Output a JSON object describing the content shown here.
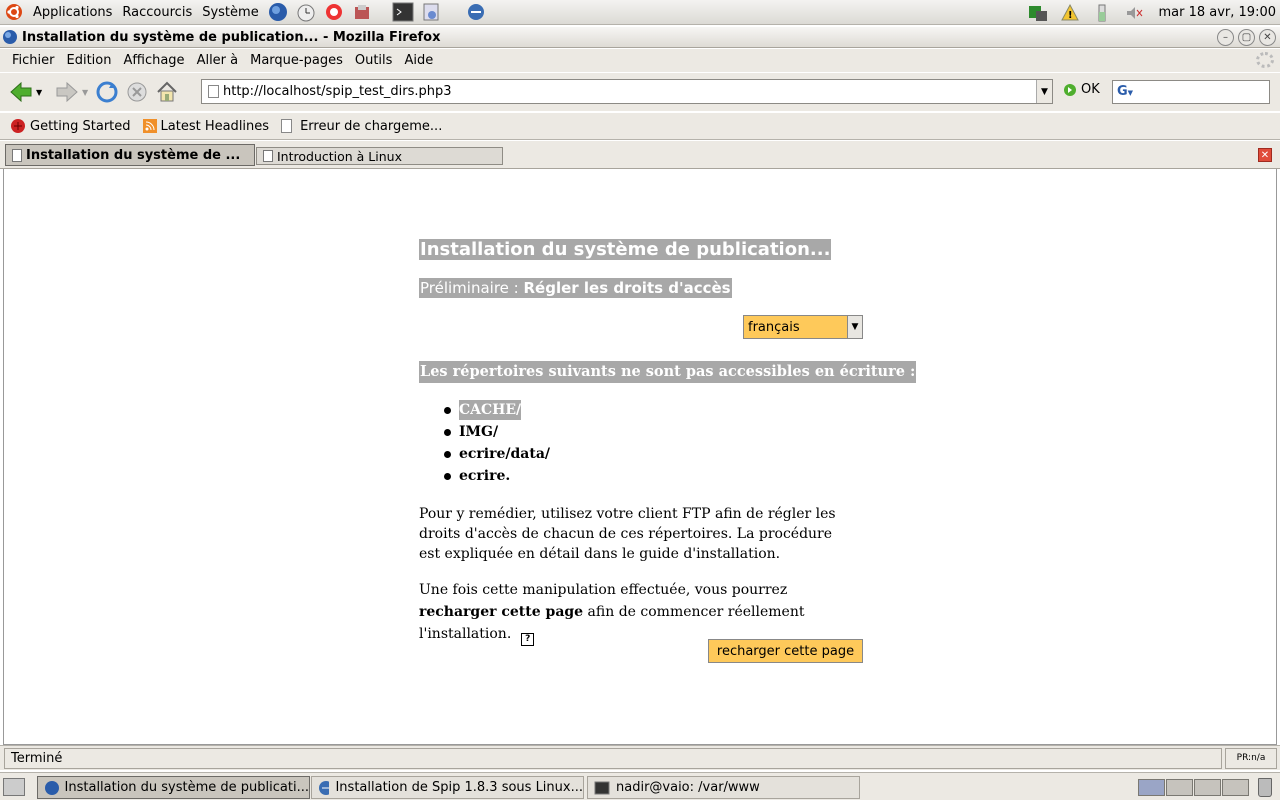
{
  "panel": {
    "menus": [
      "Applications",
      "Raccourcis",
      "Système"
    ],
    "datetime": "mar 18 avr, 19:00"
  },
  "window": {
    "title": "Installation du système de publication... - Mozilla Firefox"
  },
  "menubar": [
    "Fichier",
    "Edition",
    "Affichage",
    "Aller à",
    "Marque-pages",
    "Outils",
    "Aide"
  ],
  "nav": {
    "url": "http://localhost/spip_test_dirs.php3",
    "go_label": "OK"
  },
  "bookmarks": [
    "Getting Started",
    "Latest Headlines",
    "Erreur de chargeme..."
  ],
  "tabs": [
    {
      "label": "Installation du système de ..."
    },
    {
      "label": "Introduction à Linux"
    }
  ],
  "page": {
    "title": "Installation du système de publication...",
    "step_prefix": "Préliminaire :",
    "step_title": "Régler les droits d'accès",
    "language": "français",
    "dirs_heading": "Les répertoires suivants ne sont pas accessibles en écriture :",
    "dirs": [
      "CACHE/",
      "IMG/",
      "ecrire/data/",
      "ecrire."
    ],
    "para1": "Pour y remédier, utilisez votre client FTP afin de régler les droits d'accès de chacun de ces répertoires. La procédure est expliquée en détail dans le guide d'installation.",
    "para2_before": "Une fois cette manipulation effectuée, vous pourrez ",
    "para2_bold": "recharger cette page",
    "para2_after": " afin de commencer réellement l'installation.",
    "help_icon": "?",
    "reload_button": "recharger cette page"
  },
  "status": {
    "text": "Terminé",
    "indicator": "PR:n/a"
  },
  "taskbar": [
    {
      "label": "Installation du système de publicati..."
    },
    {
      "label": "Installation de Spip 1.8.3 sous Linux..."
    },
    {
      "label": "nadir@vaio: /var/www"
    }
  ],
  "colors": {
    "accent_orange": "#fec95a",
    "heading_gray": "#a8a8a8"
  }
}
